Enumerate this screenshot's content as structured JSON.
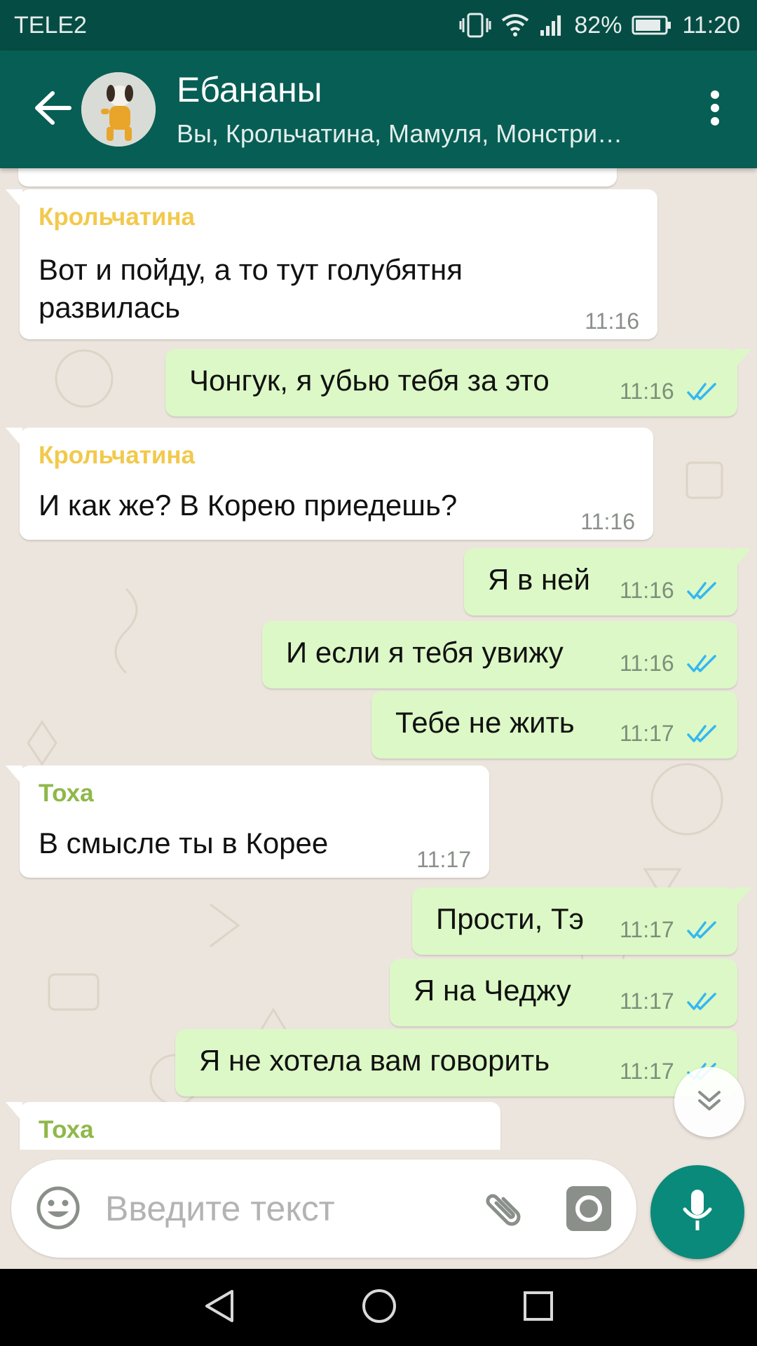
{
  "status_bar": {
    "carrier": "TELE2",
    "battery": "82%",
    "time": "11:20"
  },
  "header": {
    "title": "Ебананы",
    "subtitle": "Вы, Крольчатина, Мамуля, Монстри…",
    "icons": [
      "back-arrow-icon",
      "avatar",
      "more-vert-icon"
    ]
  },
  "messages": [
    {
      "sender": "Крольчатина",
      "lines": [
        "Вот и пойду, а то тут голубятня",
        "развилась"
      ],
      "time": "11:16"
    },
    {
      "text": "Чонгук, я убью тебя за это",
      "time": "11:16"
    },
    {
      "sender": "Крольчатина",
      "text": "И как же?  В Корею приедешь?",
      "time": "11:16"
    },
    {
      "text": "Я в ней",
      "time": "11:16"
    },
    {
      "text": "И если я тебя увижу",
      "time": "11:16"
    },
    {
      "text": "Тебе не жить",
      "time": "11:17"
    },
    {
      "sender": "Тоха",
      "text": "В смысле ты в Корее",
      "time": "11:17"
    },
    {
      "text": "Прости, Тэ",
      "time": "11:17"
    },
    {
      "text": "Я на Чеджу",
      "time": "11:17"
    },
    {
      "text": "Я не хотела вам говорить",
      "time": "11:17"
    },
    {
      "sender": "Тоха"
    }
  ],
  "composer": {
    "placeholder": "Введите текст",
    "icons": [
      "emoji-icon",
      "paperclip-icon",
      "camera-icon",
      "microphone-icon"
    ]
  },
  "colors": {
    "status_bar": "#054d44",
    "app_bar": "#075e54",
    "outgoing_bubble": "#dcf8c6",
    "incoming_bubble": "#ffffff",
    "sender_krolchatina": "#f2c94c",
    "sender_toha": "#8fb84a",
    "read_ticks": "#34b7f1",
    "mic_button": "#0a8a7a"
  },
  "nav_bar": {
    "icons": [
      "nav-back-icon",
      "nav-home-icon",
      "nav-recents-icon"
    ]
  }
}
